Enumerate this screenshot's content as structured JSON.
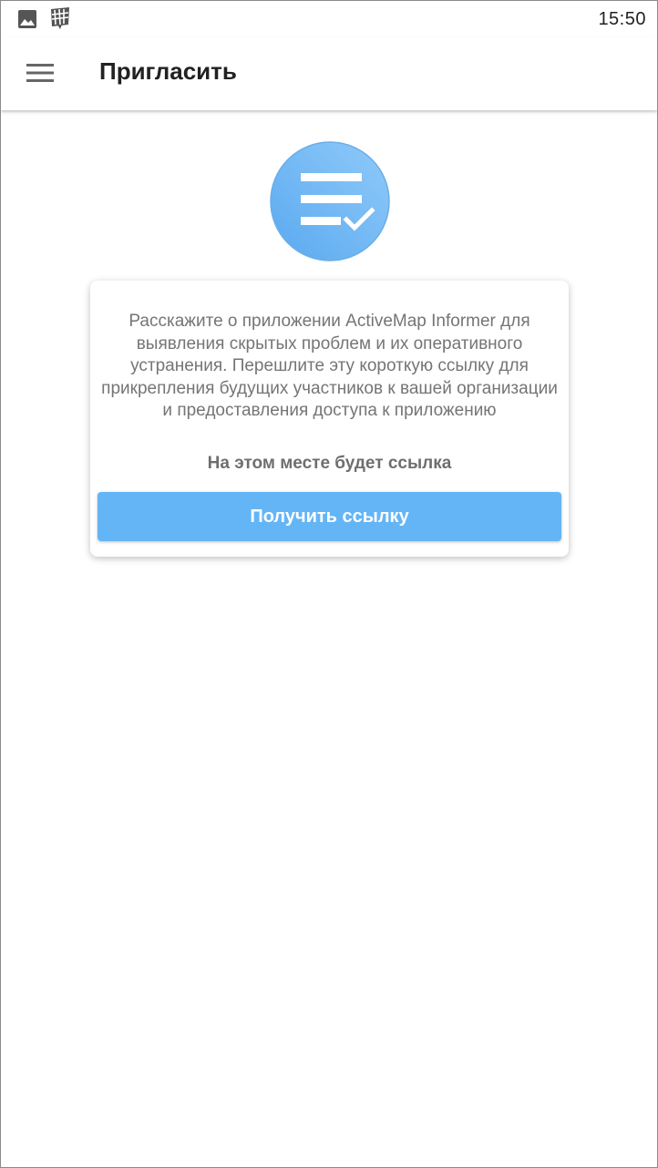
{
  "status_bar": {
    "time": "15:50",
    "icons": [
      "image-notification-icon",
      "map-notification-icon"
    ]
  },
  "app_bar": {
    "title": "Пригласить",
    "menu_icon": "hamburger-menu-icon"
  },
  "hero": {
    "icon": "checklist-icon",
    "colors": {
      "circle_light": "#90caf9",
      "circle_dark": "#5aa9f0",
      "glyph": "#ffffff"
    }
  },
  "card": {
    "description": "Расскажите о приложении ActiveMap Informer для выявления скрытых проблем и их оперативного устранения. Перешлите эту короткую ссылку для прикрепления будущих участников к вашей организации и предоставления доступа к приложению",
    "link_placeholder": "На этом месте будет ссылка",
    "button_label": "Получить ссылку",
    "button_color": "#64b5f6"
  }
}
